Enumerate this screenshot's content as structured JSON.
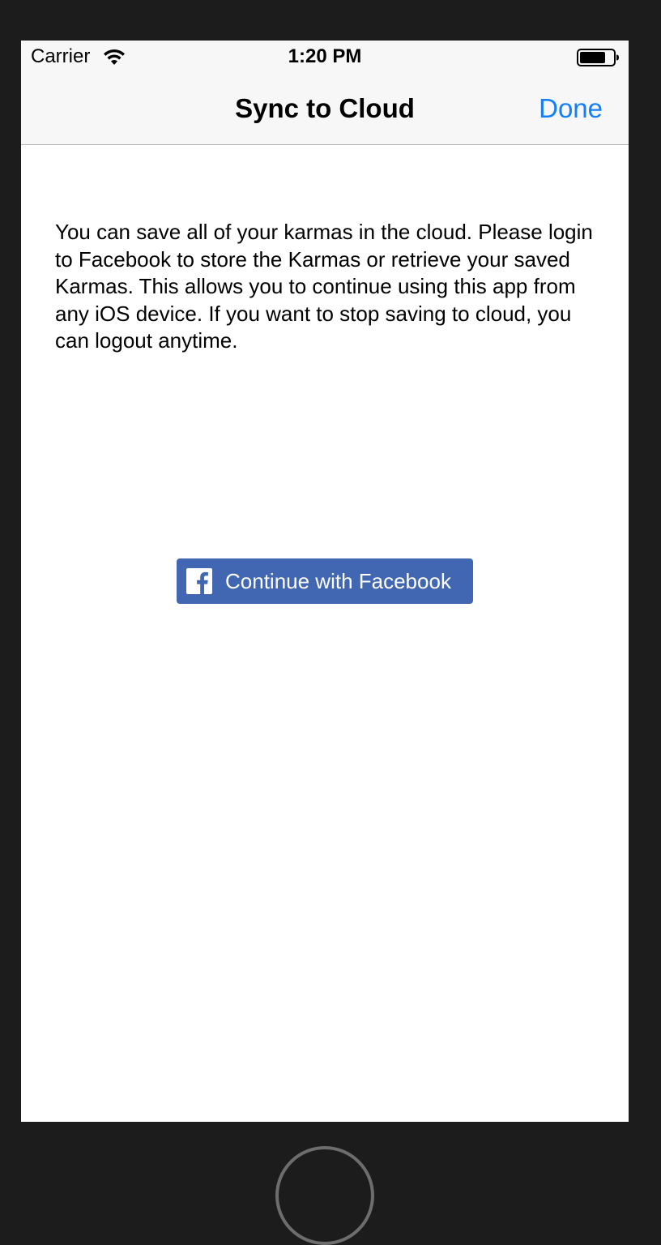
{
  "status_bar": {
    "carrier": "Carrier",
    "time": "1:20 PM",
    "wifi_icon": "wifi-icon",
    "battery_icon": "battery-icon"
  },
  "nav": {
    "title": "Sync to Cloud",
    "done_label": "Done",
    "accent_color": "#147efb"
  },
  "main": {
    "description": "You can save all of your karmas in the cloud. Please login to Facebook to store the Karmas or retrieve your saved Karmas. This allows you to continue using this app from any iOS device. If you want to stop saving to cloud, you can logout anytime."
  },
  "facebook_button": {
    "label": "Continue with Facebook",
    "icon": "facebook-icon",
    "color": "#4267b2"
  },
  "device": {
    "home_button_icon": "home-button"
  }
}
